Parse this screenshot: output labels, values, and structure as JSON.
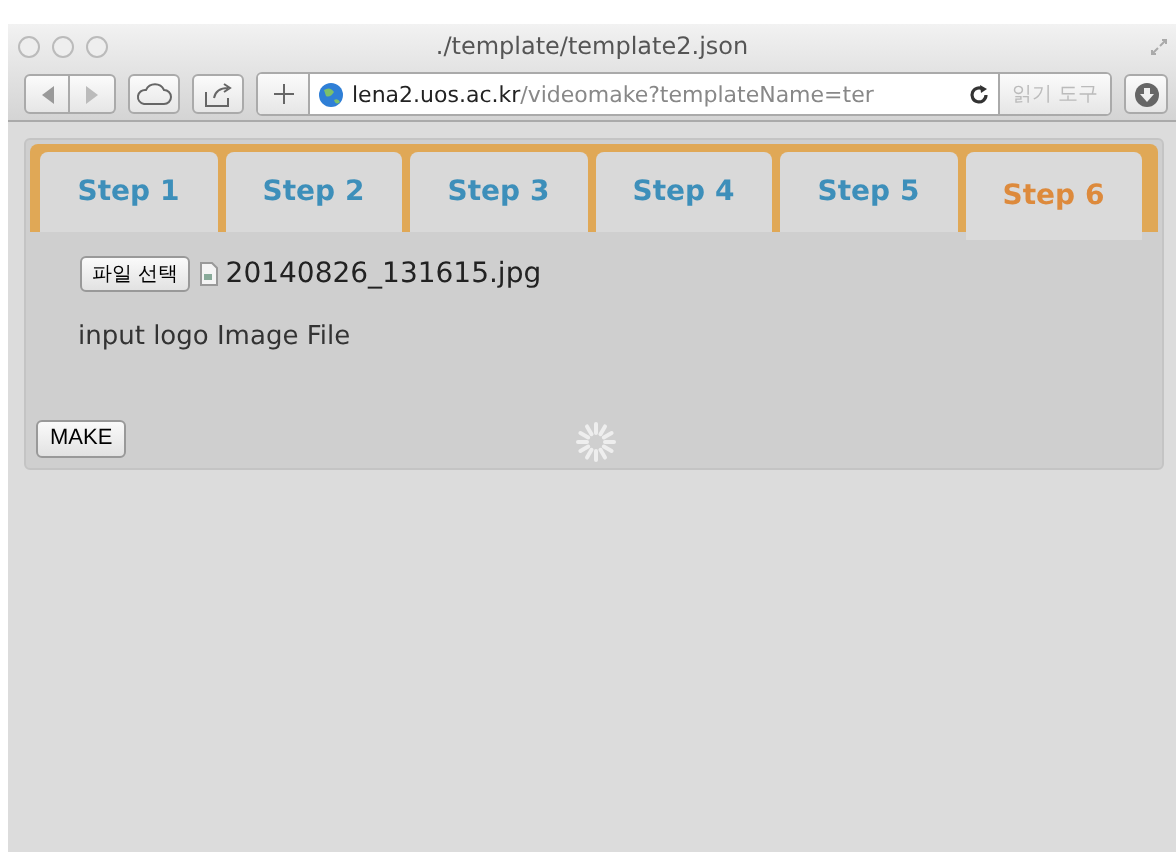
{
  "window": {
    "title": "./template/template2.json"
  },
  "toolbar": {
    "url_host": "lena2.uos.ac.kr",
    "url_path": "/videomake?templateName=ter",
    "reader_button": {
      "label": "읽기 도구",
      "disabled": true
    }
  },
  "tabs": [
    {
      "label": "Step 1",
      "selected": false
    },
    {
      "label": "Step 2",
      "selected": false
    },
    {
      "label": "Step 3",
      "selected": false
    },
    {
      "label": "Step 4",
      "selected": false
    },
    {
      "label": "Step 5",
      "selected": false
    },
    {
      "label": "Step 6",
      "selected": true
    }
  ],
  "file_input": {
    "button": "파일 선택",
    "file_name": "20140826_131615.jpg"
  },
  "instruction": "input logo Image File",
  "make_button": "MAKE"
}
